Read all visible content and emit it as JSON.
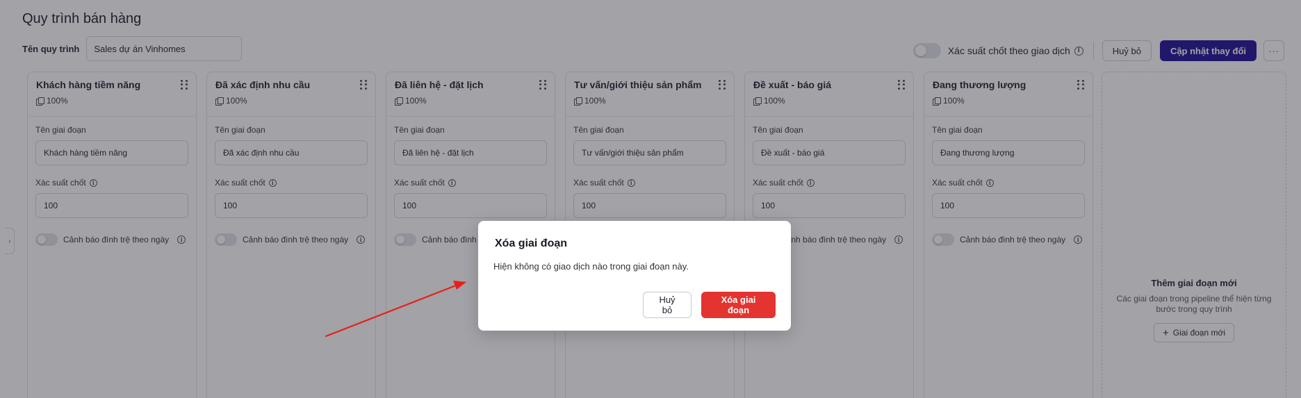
{
  "page": {
    "title": "Quy trình bán hàng",
    "name_label": "Tên quy trình",
    "name_value": "Sales dự án Vinhomes"
  },
  "toolbar": {
    "toggle_label": "Xác suất chốt theo giao dịch",
    "toggle_on": false,
    "cancel_label": "Huỷ bỏ",
    "update_label": "Cập nhật thay đổi",
    "more_label": "···"
  },
  "field_labels": {
    "name": "Tên giai đoạn",
    "probability": "Xác suất chốt",
    "stagnation_warning": "Cảnh báo đình trệ theo ngày"
  },
  "stages": [
    {
      "title": "Khách hàng tiềm năng",
      "percent": "100%",
      "name_value": "Khách hàng tiềm năng",
      "probability_value": "100",
      "warning_on": false
    },
    {
      "title": "Đã xác định nhu cầu",
      "percent": "100%",
      "name_value": "Đã xác định nhu cầu",
      "probability_value": "100",
      "warning_on": false
    },
    {
      "title": "Đã liên hệ - đặt lịch",
      "percent": "100%",
      "name_value": "Đã liên hệ - đặt lịch",
      "probability_value": "100",
      "warning_on": false
    },
    {
      "title": "Tư vấn/giới thiệu sản phẩm",
      "percent": "100%",
      "name_value": "Tư vấn/giới thiệu sản phẩm",
      "probability_value": "100",
      "warning_on": false
    },
    {
      "title": "Đề xuất - báo giá",
      "percent": "100%",
      "name_value": "Đề xuất - báo giá",
      "probability_value": "100",
      "warning_on": false
    },
    {
      "title": "Đang thương lượng",
      "percent": "100%",
      "name_value": "Đang thương lượng",
      "probability_value": "100",
      "warning_on": false
    }
  ],
  "add_stage": {
    "title": "Thêm giai đoạn mới",
    "description": "Các giai đoạn trong pipeline thể hiện từng bước trong quy trình",
    "button_label": "Giai đoạn mới"
  },
  "modal": {
    "title": "Xóa giai đoạn",
    "message": "Hiện không có giao dịch nào trong giai đoạn này.",
    "cancel_label": "Huỷ bỏ",
    "confirm_label": "Xóa giai đoạn"
  },
  "colors": {
    "primary": "#1d0d96",
    "danger": "#e3342f",
    "annotation_arrow": "#e8201a"
  },
  "icons": {
    "info": "info-circle-icon",
    "drag": "drag-handle-icon",
    "percent": "copy-icon",
    "add": "plus-icon",
    "sidebar": "chevron-right-icon"
  }
}
